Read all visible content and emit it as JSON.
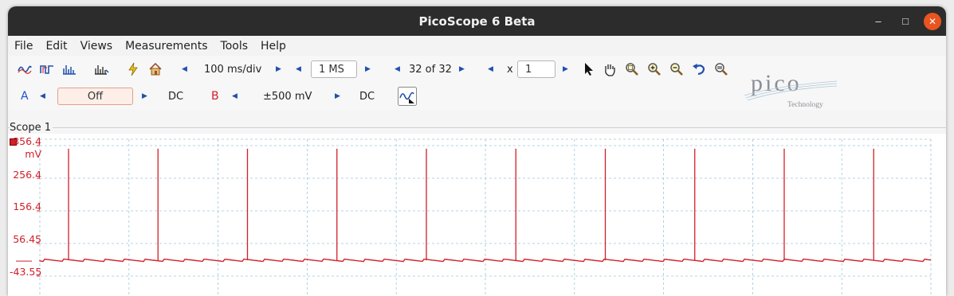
{
  "window": {
    "title": "PicoScope 6 Beta",
    "controls": {
      "minimize": "–",
      "maximize": "□",
      "close": "✕"
    }
  },
  "menubar": {
    "items": [
      "File",
      "Edit",
      "Views",
      "Measurements",
      "Tools",
      "Help"
    ]
  },
  "toolbar1": {
    "timebase": "100 ms/div",
    "samples": "1 MS",
    "buffer": "32 of 32",
    "zoom_prefix": "x",
    "zoom_value": "1"
  },
  "toolbar2": {
    "channel_a": {
      "name": "A",
      "range": "Off",
      "coupling": "DC",
      "color": "#2050d0"
    },
    "channel_b": {
      "name": "B",
      "range": "±500 mV",
      "coupling": "DC",
      "color": "#d0202a"
    }
  },
  "logo": {
    "wordmark": "pico",
    "subtext": "Technology"
  },
  "scope": {
    "title": "Scope 1",
    "y_labels": [
      "356.4",
      "mV",
      "256.4",
      "156.4",
      "56.45",
      "-43.55"
    ],
    "trace_color": "#d0202a"
  },
  "chart_data": {
    "type": "line",
    "series": [
      {
        "name": "B",
        "spike_peak_mV": 347,
        "baseline_mV": 5
      }
    ],
    "y_ticks": [
      356.4,
      256.4,
      156.4,
      56.45,
      -43.55
    ],
    "y_unit": "mV",
    "spike_count": 10,
    "grid": true
  }
}
